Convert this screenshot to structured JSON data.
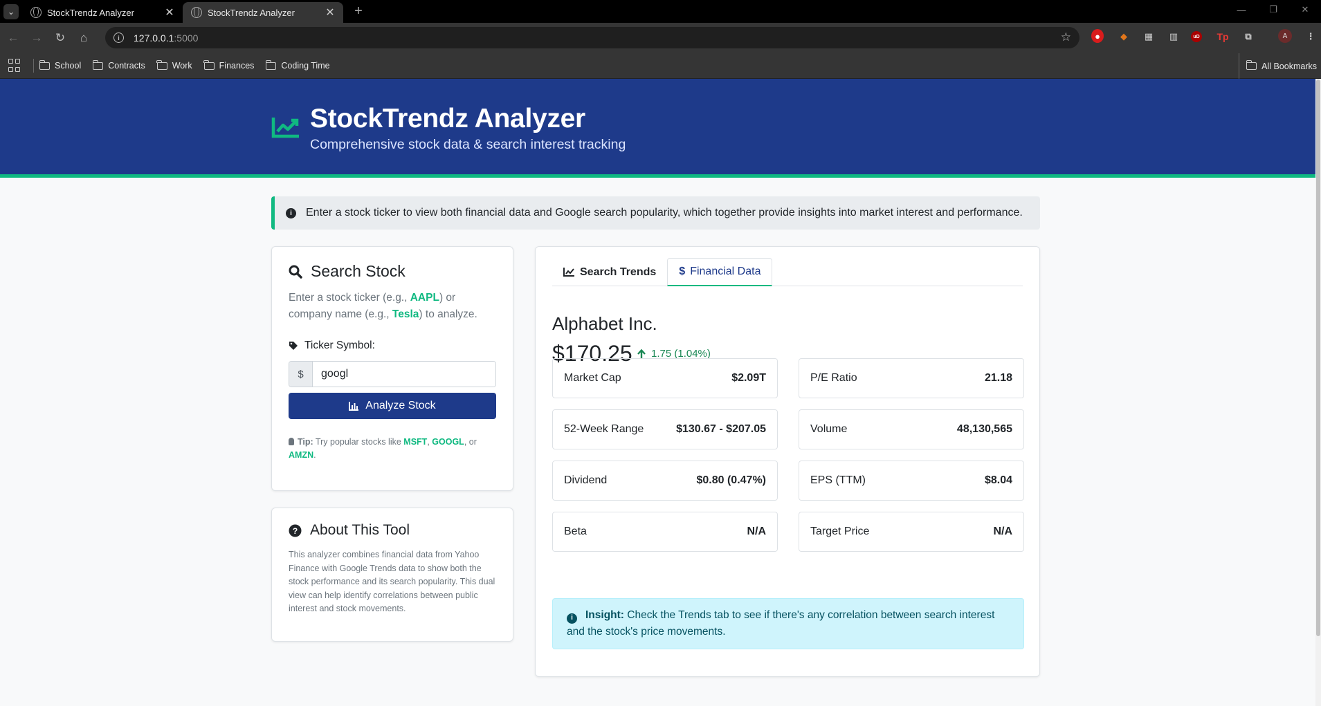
{
  "browser": {
    "tabs": [
      {
        "title": "StockTrendz Analyzer",
        "active": false
      },
      {
        "title": "StockTrendz Analyzer",
        "active": true
      }
    ],
    "url_host": "127.0.0.1",
    "url_port": ":5000",
    "bookmarks": [
      "School",
      "Contracts",
      "Work",
      "Finances",
      "Coding Time"
    ],
    "all_bookmarks": "All Bookmarks",
    "profile_initial": "A"
  },
  "header": {
    "title": "StockTrendz Analyzer",
    "subtitle": "Comprehensive stock data & search interest tracking"
  },
  "intro": "Enter a stock ticker to view both financial data and Google search popularity, which together provide insights into market interest and performance.",
  "search": {
    "title": "Search Stock",
    "hint_prefix": "Enter a stock ticker (e.g., ",
    "hint_ex1": "AAPL",
    "hint_mid": ") or company name (e.g., ",
    "hint_ex2": "Tesla",
    "hint_suffix": ") to analyze.",
    "label": "Ticker Symbol:",
    "addon": "$",
    "value": "googl",
    "button": "Analyze Stock",
    "tip_label": "Tip:",
    "tip_text": " Try popular stocks like ",
    "tip_1": "MSFT",
    "tip_2": "GOOGL",
    "tip_3": "AMZN",
    "tip_or": ", or ",
    "tip_comma": ", ",
    "tip_end": "."
  },
  "about": {
    "title": "About This Tool",
    "text": "This analyzer combines financial data from Yahoo Finance with Google Trends data to show both the stock performance and its search popularity. This dual view can help identify correlations between public interest and stock movements."
  },
  "tabs": [
    {
      "label": "Search Trends",
      "active": false
    },
    {
      "label": "Financial Data",
      "active": true
    }
  ],
  "stock": {
    "company": "Alphabet Inc.",
    "price": "$170.25",
    "change": "1.75 (1.04%)",
    "metrics": [
      {
        "label": "Market Cap",
        "value": "$2.09T"
      },
      {
        "label": "P/E Ratio",
        "value": "21.18"
      },
      {
        "label": "52-Week Range",
        "value": "$130.67 - $207.05"
      },
      {
        "label": "Volume",
        "value": "48,130,565"
      },
      {
        "label": "Dividend",
        "value": "$0.80 (0.47%)"
      },
      {
        "label": "EPS (TTM)",
        "value": "$8.04"
      },
      {
        "label": "Beta",
        "value": "N/A"
      },
      {
        "label": "Target Price",
        "value": "N/A"
      }
    ]
  },
  "insight": {
    "label": "Insight:",
    "text": " Check the Trends tab to see if there's any correlation between search interest and the stock's price movements."
  },
  "colors": {
    "header_bg": "#1e3a8a",
    "accent": "#10b981",
    "positive": "#198754",
    "insight_bg": "#cff4fc"
  }
}
